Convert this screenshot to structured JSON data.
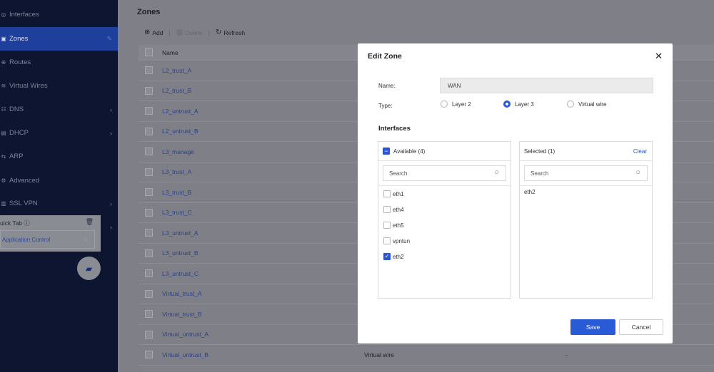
{
  "sidebar": {
    "items": [
      {
        "label": "Interfaces",
        "icon": "interfaces-icon",
        "glyph": "◎"
      },
      {
        "label": "Zones",
        "icon": "zones-icon",
        "glyph": "▣"
      },
      {
        "label": "Routes",
        "icon": "routes-icon",
        "glyph": "⊕"
      },
      {
        "label": "Virtual Wires",
        "icon": "virtual-wires-icon",
        "glyph": "≋"
      },
      {
        "label": "DNS",
        "icon": "dns-icon",
        "glyph": "☷"
      },
      {
        "label": "DHCP",
        "icon": "dhcp-icon",
        "glyph": "▤"
      },
      {
        "label": "ARP",
        "icon": "arp-icon",
        "glyph": "⇆"
      },
      {
        "label": "Advanced",
        "icon": "advanced-icon",
        "glyph": "⚙"
      },
      {
        "label": "SSL VPN",
        "icon": "ssl-vpn-icon",
        "glyph": "▥"
      }
    ],
    "quick_tab": {
      "title": "uick Tab",
      "item": "Application Control"
    }
  },
  "main": {
    "title": "Zones",
    "toolbar": {
      "add": "Add",
      "delete": "Delete",
      "refresh": "Refresh"
    },
    "table": {
      "headers": {
        "name": "Name"
      },
      "rows": [
        {
          "name": "L2_trust_A",
          "type": "",
          "ifs": ""
        },
        {
          "name": "L2_trust_B",
          "type": "",
          "ifs": ""
        },
        {
          "name": "L2_untrust_A",
          "type": "",
          "ifs": ""
        },
        {
          "name": "L2_untrust_B",
          "type": "",
          "ifs": ""
        },
        {
          "name": "L3_manage",
          "type": "",
          "ifs": ""
        },
        {
          "name": "L3_trust_A",
          "type": "",
          "ifs": ""
        },
        {
          "name": "L3_trust_B",
          "type": "",
          "ifs": ""
        },
        {
          "name": "L3_trust_C",
          "type": "",
          "ifs": ""
        },
        {
          "name": "L3_untrust_A",
          "type": "",
          "ifs": ""
        },
        {
          "name": "L3_untrust_B",
          "type": "",
          "ifs": ""
        },
        {
          "name": "L3_untrust_C",
          "type": "",
          "ifs": ""
        },
        {
          "name": "Virtual_trust_A",
          "type": "",
          "ifs": ""
        },
        {
          "name": "Virtual_trust_B",
          "type": "",
          "ifs": ""
        },
        {
          "name": "Virtual_untrust_A",
          "type": "",
          "ifs": ""
        },
        {
          "name": "Virtual_untrust_B",
          "type": "Virtual wire",
          "ifs": "-"
        }
      ]
    }
  },
  "modal": {
    "title": "Edit Zone",
    "name_label": "Name:",
    "name_value": "WAN",
    "type_label": "Type:",
    "types": [
      "Layer 2",
      "Layer 3",
      "Virtual wire"
    ],
    "selected_type": "Layer 3",
    "interfaces_title": "Interfaces",
    "available": {
      "header": "Available (4)",
      "search_placeholder": "Search",
      "options": [
        {
          "label": "eth1",
          "checked": false
        },
        {
          "label": "eth4",
          "checked": false
        },
        {
          "label": "eth5",
          "checked": false
        },
        {
          "label": "vpntun",
          "checked": false
        },
        {
          "label": "eth2",
          "checked": true
        }
      ]
    },
    "selected": {
      "header": "Selected (1)",
      "clear": "Clear",
      "search_placeholder": "Search",
      "items": [
        "eth2"
      ]
    },
    "save": "Save",
    "cancel": "Cancel"
  },
  "colors": {
    "accent": "#2a55d3",
    "sidebar_bg": "#0d1531",
    "sidebar_active": "#1f3f9c"
  }
}
